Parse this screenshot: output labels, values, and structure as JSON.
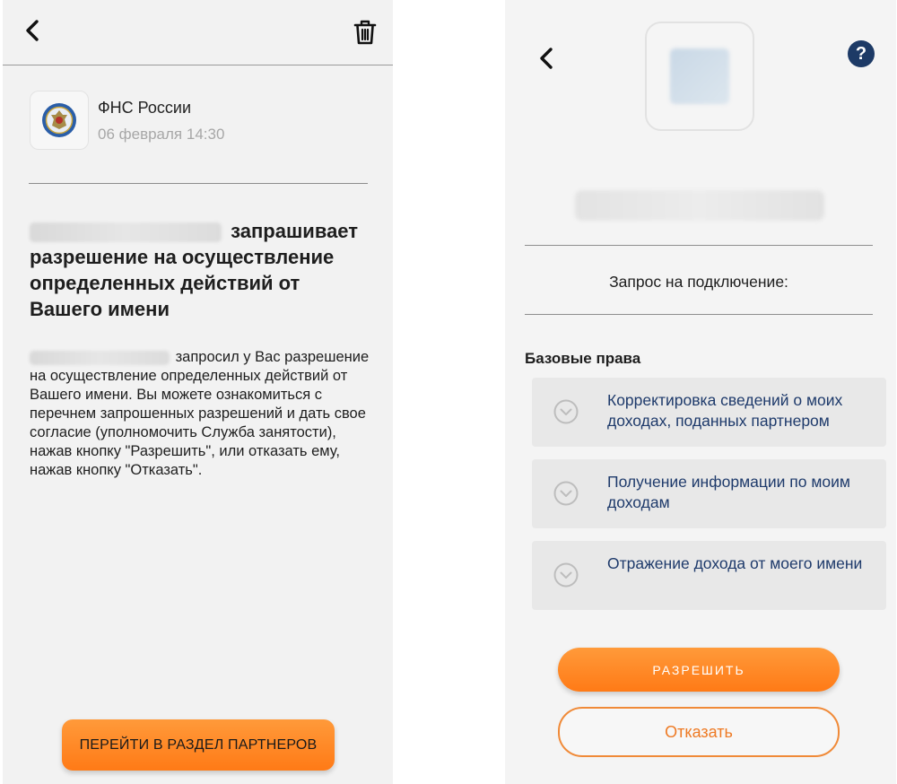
{
  "left_screen": {
    "header": {
      "back_icon": "chevron-left-icon",
      "delete_icon": "trash-icon"
    },
    "sender": {
      "logo_icon": "fns-emblem-icon",
      "name": "ФНС России",
      "date": "06 февраля 14:30"
    },
    "heading": {
      "text": "запрашивает разрешение на осуществление определенных действий от Вашего имени"
    },
    "body": {
      "text": "запросил у Вас разрешение на осуществление определенных действий от Вашего имени. Вы можете ознакомиться с перечнем запрошенных разрешений и дать свое согласие (уполномочить Служба занятости), нажав кнопку \"Разрешить\", или отказать ему, нажав кнопку \"Отказать\"."
    },
    "partners_button": "ПЕРЕЙТИ В РАЗДЕЛ ПАРТНЕРОВ"
  },
  "right_screen": {
    "header": {
      "back_icon": "chevron-left-icon",
      "help_label": "?"
    },
    "request_label": "Запрос на подключение:",
    "rights_title": "Базовые права",
    "rights": [
      {
        "label": "Корректировка сведений о моих доходах, поданных партнером",
        "icon": "chevron-down-circle-icon"
      },
      {
        "label": "Получение информации по моим доходам",
        "icon": "chevron-down-circle-icon"
      },
      {
        "label": "Отражение дохода от моего имени",
        "icon": "chevron-down-circle-icon"
      }
    ],
    "allow_button": "РАЗРЕШИТЬ",
    "deny_button": "Отказать"
  },
  "colors": {
    "accent_orange": "#ff7a16",
    "link_blue": "#1e3a6b",
    "help_blue": "#1d3a66"
  }
}
